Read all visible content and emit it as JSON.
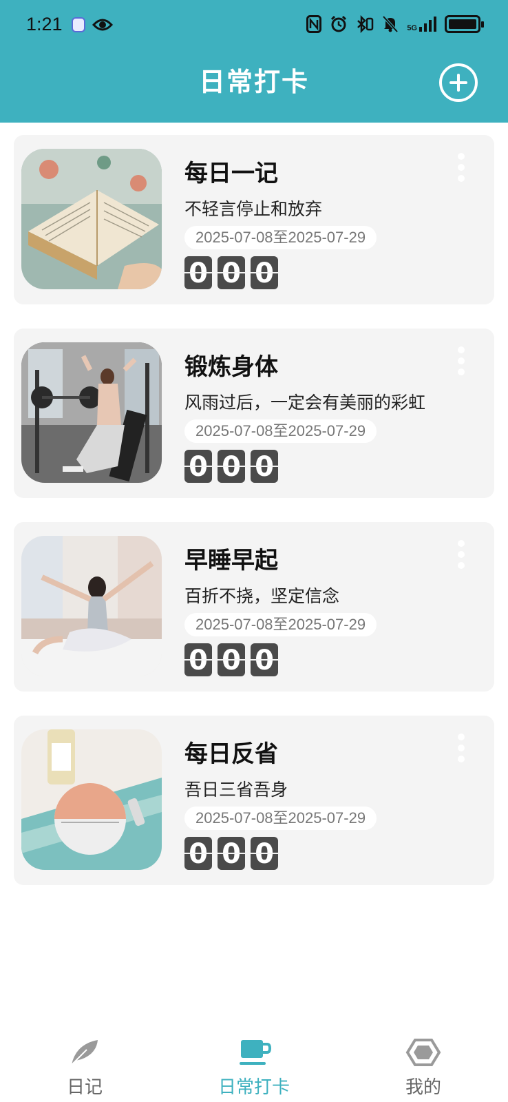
{
  "status_bar": {
    "time": "1:21",
    "network_label": "5G"
  },
  "header": {
    "title": "日常打卡",
    "add_icon": "plus-circle-icon",
    "background_color": "#3eb1bf"
  },
  "habits": [
    {
      "title": "每日一记",
      "subtitle": "不轻言停止和放弃",
      "date_range": "2025-07-08至2025-07-29",
      "counter": [
        "0",
        "0",
        "0"
      ],
      "image": "open-book-photo"
    },
    {
      "title": "锻炼身体",
      "subtitle": "风雨过后，一定会有美丽的彩虹",
      "date_range": "2025-07-08至2025-07-29",
      "counter": [
        "0",
        "0",
        "0"
      ],
      "image": "gym-workout-photo"
    },
    {
      "title": "早睡早起",
      "subtitle": "百折不挠，坚定信念",
      "date_range": "2025-07-08至2025-07-29",
      "counter": [
        "0",
        "0",
        "0"
      ],
      "image": "morning-stretch-photo"
    },
    {
      "title": "每日反省",
      "subtitle": "吾日三省吾身",
      "date_range": "2025-07-08至2025-07-29",
      "counter": [
        "0",
        "0",
        "0"
      ],
      "image": "perfume-bottle-photo"
    }
  ],
  "bottom_nav": {
    "items": [
      {
        "label": "日记",
        "icon": "feather-icon",
        "active": false
      },
      {
        "label": "日常打卡",
        "icon": "cup-icon",
        "active": true
      },
      {
        "label": "我的",
        "icon": "hexagon-icon",
        "active": false
      }
    ],
    "active_color": "#3eb1bf"
  }
}
